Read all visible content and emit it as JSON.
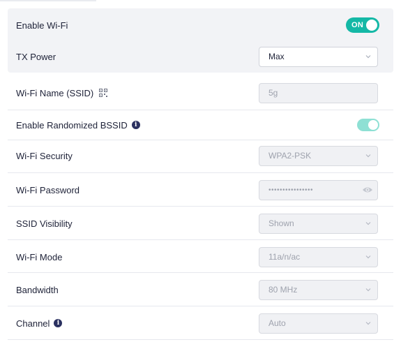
{
  "settings": {
    "enable_wifi": {
      "label": "Enable Wi-Fi",
      "toggle": "ON"
    },
    "tx_power": {
      "label": "TX Power",
      "value": "Max"
    },
    "ssid": {
      "label": "Wi-Fi Name (SSID)",
      "value": "5g"
    },
    "random_bssid": {
      "label": "Enable Randomized BSSID"
    },
    "security": {
      "label": "Wi-Fi Security",
      "value": "WPA2-PSK"
    },
    "password": {
      "label": "Wi-Fi Password",
      "value": "••••••••••••••••"
    },
    "visibility": {
      "label": "SSID Visibility",
      "value": "Shown"
    },
    "mode": {
      "label": "Wi-Fi Mode",
      "value": "11a/n/ac"
    },
    "bandwidth": {
      "label": "Bandwidth",
      "value": "80 MHz"
    },
    "channel": {
      "label": "Channel",
      "value": "Auto"
    }
  },
  "colors": {
    "accent": "#14b8a6",
    "accent_disabled": "#8ee0d4",
    "text": "#1e2238",
    "muted": "#9ea2ad"
  }
}
